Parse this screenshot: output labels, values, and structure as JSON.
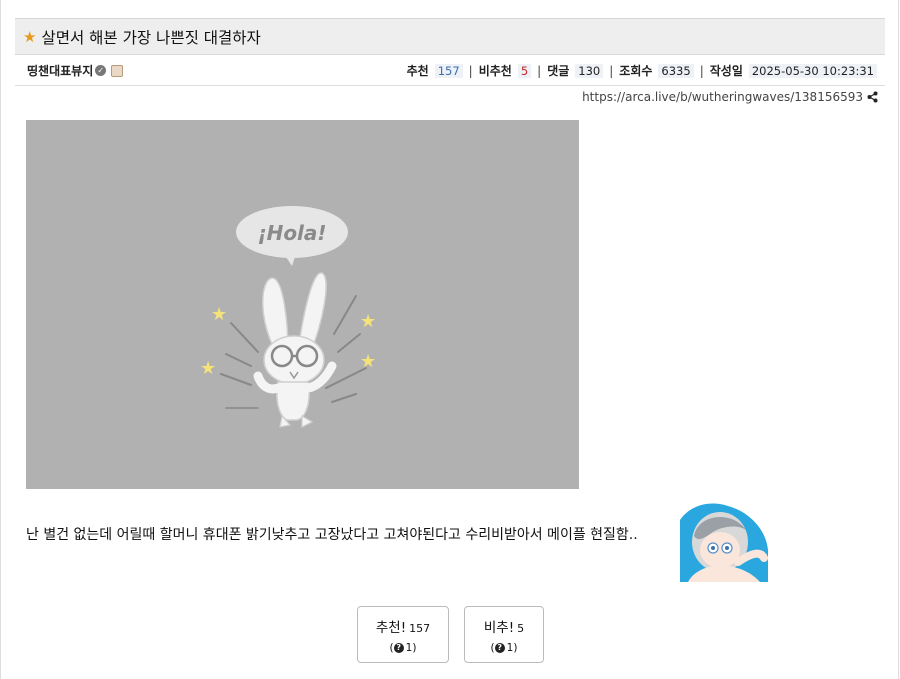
{
  "post": {
    "title": "살면서 해본 가장 나쁜짓 대결하자",
    "author": "띵챈대표뷰지",
    "url": "https://arca.live/b/wutheringwaves/138156593",
    "body_text": "난 별건 없는데 어릴때 할머니 휴대폰 밝기낮추고 고장났다고 고쳐야된다고 수리비받아서 메이플 현질함.."
  },
  "stats": {
    "recommend_label": "추천",
    "recommend_value": "157",
    "downvote_label": "비추천",
    "downvote_value": "5",
    "comments_label": "댓글",
    "comments_value": "130",
    "views_label": "조회수",
    "views_value": "6335",
    "date_label": "작성일",
    "date_value": "2025-05-30 10:23:31",
    "separator": "|"
  },
  "image": {
    "speech_text": "¡Hola!"
  },
  "votes": {
    "up_label": "추천!",
    "up_count": "157",
    "up_sub": "1)",
    "down_label": "비추!",
    "down_count": "5",
    "down_sub": "1)"
  },
  "colors": {
    "star": "#e89a1e",
    "placeholder_bg": "#b1b1b1",
    "recommend": "#3a6db3",
    "downvote": "#c62828"
  }
}
